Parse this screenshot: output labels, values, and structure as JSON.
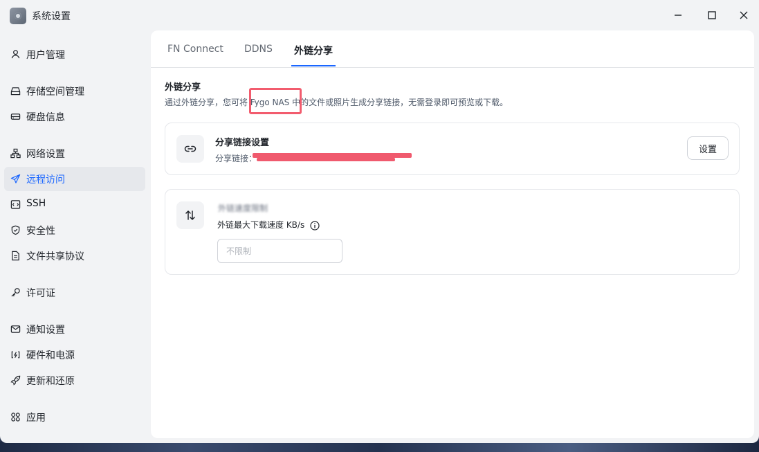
{
  "window": {
    "title": "系统设置",
    "controls": [
      "minimize-icon",
      "maximize-icon",
      "close-icon"
    ]
  },
  "sidebar": {
    "items": [
      {
        "label": "用户管理",
        "icon": "user-icon",
        "active": false
      },
      {
        "label": "存储空间管理",
        "icon": "storage-icon",
        "active": false
      },
      {
        "label": "硬盘信息",
        "icon": "harddisk-icon",
        "active": false
      },
      {
        "label": "网络设置",
        "icon": "network-icon",
        "active": false
      },
      {
        "label": "远程访问",
        "icon": "send-icon",
        "active": true
      },
      {
        "label": "SSH",
        "icon": "terminal-icon",
        "active": false
      },
      {
        "label": "安全性",
        "icon": "shield-icon",
        "active": false
      },
      {
        "label": "文件共享协议",
        "icon": "document-icon",
        "active": false
      },
      {
        "label": "许可证",
        "icon": "key-icon",
        "active": false
      },
      {
        "label": "通知设置",
        "icon": "mail-icon",
        "active": false
      },
      {
        "label": "硬件和电源",
        "icon": "power-icon",
        "active": false
      },
      {
        "label": "更新和还原",
        "icon": "rocket-icon",
        "active": false
      },
      {
        "label": "应用",
        "icon": "apps-grid-icon",
        "active": false
      }
    ]
  },
  "tabs": [
    {
      "label": "FN Connect",
      "active": false
    },
    {
      "label": "DDNS",
      "active": false
    },
    {
      "label": "外链分享",
      "active": true
    }
  ],
  "main": {
    "section_title": "外链分享",
    "description": "通过外链分享，您可将 Fygo NAS 中的文件或照片生成分享链接，无需登录即可预览或下载。",
    "share_link_card": {
      "icon": "link-icon",
      "title": "分享链接设置",
      "link_label": "分享链接：",
      "button_label": "设置"
    },
    "speed_card": {
      "icon": "transfer-arrows-icon",
      "title_blurred": "外链速度限制",
      "field_label": "外链最大下载速度 KB/s",
      "info_icon": "info-icon",
      "input_placeholder": "不限制",
      "input_value": ""
    }
  },
  "colors": {
    "accent": "#1a66ff",
    "highlight": "#f25c6e",
    "sidebar_bg": "#f2f3f5",
    "active_item_bg": "#e6e8ec"
  }
}
